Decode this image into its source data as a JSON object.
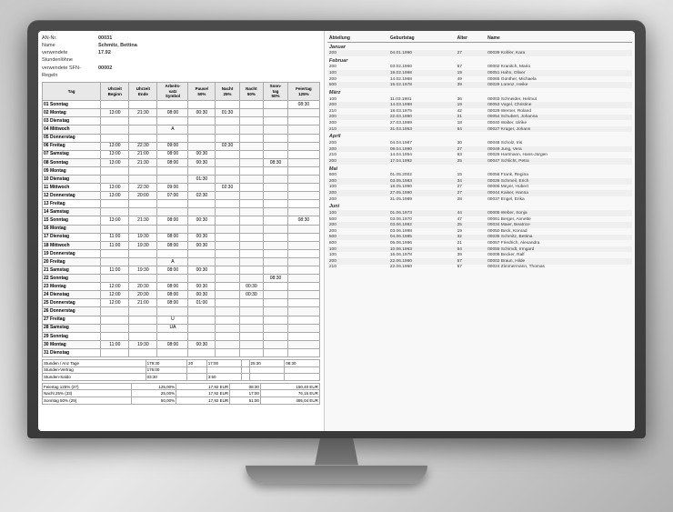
{
  "monitor": {
    "title": "Monitor Display"
  },
  "left": {
    "header": [
      {
        "label": "AN-Nr.",
        "value": "00031"
      },
      {
        "label": "Name",
        "value": "Schmitz, Bettina"
      },
      {
        "label": "verwendete Stundenlöhne",
        "value": "17.92"
      },
      {
        "label": "verwendete SFN-Regeln",
        "value": "00002"
      }
    ],
    "table_headers": [
      "Tag",
      "Uhrzeit Beginn",
      "Uhrzeit Ende",
      "Arbeitssatz Symbol",
      "Pause/ 50%",
      "Nacht 25%",
      "Nacht 50%",
      "Sonntag 50%",
      "Feiertag 125%"
    ],
    "rows": [
      {
        "nr": "01",
        "tag": "Sonntag",
        "begin": "",
        "end": "",
        "as": "",
        "pause": "",
        "n25": "",
        "n50": "",
        "so": "",
        "ft": "08:30"
      },
      {
        "nr": "02",
        "tag": "Montag",
        "begin": "13:00",
        "end": "21:30",
        "as": "08:00",
        "pause": "00:30",
        "n25": "01:30",
        "n50": "",
        "so": "",
        "ft": ""
      },
      {
        "nr": "03",
        "tag": "Dienstag",
        "begin": "",
        "end": "",
        "as": "",
        "pause": "",
        "n25": "",
        "n50": "",
        "so": "",
        "ft": ""
      },
      {
        "nr": "04",
        "tag": "Mittwoch",
        "begin": "",
        "end": "",
        "as": "A",
        "pause": "",
        "n25": "",
        "n50": "",
        "so": "",
        "ft": ""
      },
      {
        "nr": "05",
        "tag": "Donnerstag",
        "begin": "",
        "end": "",
        "as": "",
        "pause": "",
        "n25": "",
        "n50": "",
        "so": "",
        "ft": ""
      },
      {
        "nr": "06",
        "tag": "Freitag",
        "begin": "13:00",
        "end": "22:30",
        "as": "09:00",
        "pause": "",
        "n25": "02:30",
        "n50": "",
        "so": "",
        "ft": ""
      },
      {
        "nr": "07",
        "tag": "Samstag",
        "begin": "13:00",
        "end": "21:00",
        "as": "08:00",
        "pause": "00:30",
        "n25": "",
        "n50": "",
        "so": "",
        "ft": ""
      },
      {
        "nr": "08",
        "tag": "Sonntag",
        "begin": "13:00",
        "end": "21:30",
        "as": "08:00",
        "pause": "00:30",
        "n25": "",
        "n50": "",
        "so": "08:30",
        "ft": ""
      },
      {
        "nr": "09",
        "tag": "Montag",
        "begin": "",
        "end": "",
        "as": "",
        "pause": "",
        "n25": "",
        "n50": "",
        "so": "",
        "ft": ""
      },
      {
        "nr": "10",
        "tag": "Dienstag",
        "begin": "",
        "end": "",
        "as": "",
        "pause": "01:30",
        "n25": "",
        "n50": "",
        "so": "",
        "ft": ""
      },
      {
        "nr": "11",
        "tag": "Mittwoch",
        "begin": "13:00",
        "end": "22:30",
        "as": "09:00",
        "pause": "",
        "n25": "02:30",
        "n50": "",
        "so": "",
        "ft": ""
      },
      {
        "nr": "12",
        "tag": "Donnerstag",
        "begin": "13:00",
        "end": "20:00",
        "as": "07:00",
        "pause": "02:30",
        "n25": "",
        "n50": "",
        "so": "",
        "ft": ""
      },
      {
        "nr": "13",
        "tag": "Freitag",
        "begin": "",
        "end": "",
        "as": "",
        "pause": "",
        "n25": "",
        "n50": "",
        "so": "",
        "ft": ""
      },
      {
        "nr": "14",
        "tag": "Samstag",
        "begin": "",
        "end": "",
        "as": "",
        "pause": "",
        "n25": "",
        "n50": "",
        "so": "",
        "ft": ""
      },
      {
        "nr": "15",
        "tag": "Sonntag",
        "begin": "13:00",
        "end": "21:30",
        "as": "08:00",
        "pause": "00:30",
        "n25": "",
        "n50": "",
        "so": "",
        "ft": "08:30"
      },
      {
        "nr": "16",
        "tag": "Montag",
        "begin": "",
        "end": "",
        "as": "",
        "pause": "",
        "n25": "",
        "n50": "",
        "so": "",
        "ft": ""
      },
      {
        "nr": "17",
        "tag": "Dienstag",
        "begin": "11:00",
        "end": "19:30",
        "as": "08:00",
        "pause": "00:30",
        "n25": "",
        "n50": "",
        "so": "",
        "ft": ""
      },
      {
        "nr": "18",
        "tag": "Mittwoch",
        "begin": "11:00",
        "end": "19:30",
        "as": "08:00",
        "pause": "00:30",
        "n25": "",
        "n50": "",
        "so": "",
        "ft": ""
      },
      {
        "nr": "19",
        "tag": "Donnerstag",
        "begin": "",
        "end": "",
        "as": "",
        "pause": "",
        "n25": "",
        "n50": "",
        "so": "",
        "ft": ""
      },
      {
        "nr": "20",
        "tag": "Freitag",
        "begin": "",
        "end": "",
        "as": "A",
        "pause": "",
        "n25": "",
        "n50": "",
        "so": "",
        "ft": ""
      },
      {
        "nr": "21",
        "tag": "Samstag",
        "begin": "11:00",
        "end": "19:30",
        "as": "08:00",
        "pause": "00:30",
        "n25": "",
        "n50": "",
        "so": "",
        "ft": ""
      },
      {
        "nr": "22",
        "tag": "Sonntag",
        "begin": "",
        "end": "",
        "as": "",
        "pause": "",
        "n25": "",
        "n50": "",
        "so": "08:30",
        "ft": ""
      },
      {
        "nr": "23",
        "tag": "Montag",
        "begin": "12:00",
        "end": "20:30",
        "as": "08:00",
        "pause": "00:30",
        "n25": "",
        "n50": "00:30",
        "so": "",
        "ft": ""
      },
      {
        "nr": "24",
        "tag": "Dienstag",
        "begin": "12:00",
        "end": "20:30",
        "as": "08:00",
        "pause": "00:30",
        "n25": "",
        "n50": "00:30",
        "so": "",
        "ft": ""
      },
      {
        "nr": "25",
        "tag": "Donnerstag",
        "begin": "12:00",
        "end": "21:00",
        "as": "08:00",
        "pause": "01:00",
        "n25": "",
        "n50": "",
        "so": "",
        "ft": ""
      },
      {
        "nr": "26",
        "tag": "Donnerstag",
        "begin": "",
        "end": "",
        "as": "",
        "pause": "",
        "n25": "",
        "n50": "",
        "so": "",
        "ft": ""
      },
      {
        "nr": "27",
        "tag": "Freitag",
        "begin": "",
        "end": "",
        "as": "U",
        "pause": "",
        "n25": "",
        "n50": "",
        "so": "",
        "ft": ""
      },
      {
        "nr": "28",
        "tag": "Samstag",
        "begin": "",
        "end": "",
        "as": "UA",
        "pause": "",
        "n25": "",
        "n50": "",
        "so": "",
        "ft": ""
      },
      {
        "nr": "29",
        "tag": "Sonntag",
        "begin": "",
        "end": "",
        "as": "",
        "pause": "",
        "n25": "",
        "n50": "",
        "so": "",
        "ft": ""
      },
      {
        "nr": "30",
        "tag": "Montag",
        "begin": "11:00",
        "end": "19:30",
        "as": "08:00",
        "pause": "00:30",
        "n25": "",
        "n50": "",
        "so": "",
        "ft": ""
      },
      {
        "nr": "31",
        "tag": "Dienstag",
        "begin": "",
        "end": "",
        "as": "",
        "pause": "",
        "n25": "",
        "n50": "",
        "so": "",
        "ft": ""
      }
    ],
    "summary": [
      {
        "label": "Stunden / Anz Tage",
        "v1": "179:30",
        "v2": "20",
        "v3": "17:00",
        "v4": "",
        "v5": "25:30",
        "v6": "08:30"
      },
      {
        "label": "Stunden-Vertrag",
        "v1": "176:00",
        "v2": "",
        "v3": "",
        "v4": "",
        "v5": "",
        "v6": ""
      },
      {
        "label": "Stunden-Saldo",
        "v1": "03:30",
        "v2": "",
        "v3": "3:50",
        "v4": "",
        "v5": "",
        "v6": ""
      }
    ],
    "fees": [
      {
        "label": "Feiertag 125% (27)",
        "pct": "125,00%",
        "rate": "17,92 EUR",
        "hrs": "08:30",
        "total": "150,40 EUR"
      },
      {
        "label": "Nacht 25% (33)",
        "pct": "25,00%",
        "rate": "17,92 EUR",
        "hrs": "17:00",
        "total": "76,16 EUR"
      },
      {
        "label": "Sonntag 50% (29)",
        "pct": "50,00%",
        "rate": "17,92 EUR",
        "hrs": "51:00",
        "total": "495,04 EUR"
      }
    ]
  },
  "right": {
    "col_headers": [
      "Abteilung",
      "Geburtstag",
      "Alter",
      "Name"
    ],
    "months": [
      {
        "name": "Januar",
        "rows": [
          {
            "abt": "200",
            "geb": "04.01.1990",
            "alt": "27",
            "name": "00039 Kohler, Kara"
          }
        ]
      },
      {
        "name": "Februar",
        "rows": [
          {
            "abt": "200",
            "geb": "03.02.1960",
            "alt": "57",
            "name": "00002 Kranitch, Mario"
          },
          {
            "abt": "100",
            "geb": "19.02.1998",
            "alt": "19",
            "name": "00051 Hahn, Oliver"
          },
          {
            "abt": "200",
            "geb": "14.02.1968",
            "alt": "49",
            "name": "00065 Günther, Michaela"
          },
          {
            "abt": "500",
            "geb": "15.02.1978",
            "alt": "39",
            "name": "00029 Lorenz, Heike"
          }
        ]
      },
      {
        "name": "März",
        "rows": [
          {
            "abt": "100",
            "geb": "11.03.1981",
            "alt": "36",
            "name": "00003 Schneider, Helmut"
          },
          {
            "abt": "200",
            "geb": "14.03.1998",
            "alt": "19",
            "name": "00053 Vogel, Christine"
          },
          {
            "abt": "210",
            "geb": "18.03.1975",
            "alt": "42",
            "name": "00029 Werner, Roland"
          },
          {
            "abt": "200",
            "geb": "22.03.1990",
            "alt": "21",
            "name": "00054 Schubert, Johanna"
          },
          {
            "abt": "200",
            "geb": "27.03.1999",
            "alt": "18",
            "name": "00040 Walter, Ulrike"
          },
          {
            "abt": "210",
            "geb": "31.03.1953",
            "alt": "64",
            "name": "00027 Krüger, Johann"
          }
        ]
      },
      {
        "name": "April",
        "rows": [
          {
            "abt": "200",
            "geb": "04.04.1987",
            "alt": "30",
            "name": "00048 Scholz, Iris"
          },
          {
            "abt": "200",
            "geb": "08.04.1990",
            "alt": "27",
            "name": "00049 Jung, Vera"
          },
          {
            "abt": "210",
            "geb": "14.04.1954",
            "alt": "63",
            "name": "00026 Hartmann, Hans-Jürgen"
          },
          {
            "abt": "200",
            "geb": "17.04.1992",
            "alt": "25",
            "name": "00047 Schlicht, Petra"
          }
        ]
      },
      {
        "name": "Mai",
        "rows": [
          {
            "abt": "600",
            "geb": "01.05.2002",
            "alt": "15",
            "name": "00056 Frank, Regina"
          },
          {
            "abt": "200",
            "geb": "03.05.1983",
            "alt": "34",
            "name": "00028 Schmeil, Erich"
          },
          {
            "abt": "100",
            "geb": "18.05.1990",
            "alt": "27",
            "name": "00006 Meyer, Hubert"
          },
          {
            "abt": "200",
            "geb": "27.05.1990",
            "alt": "27",
            "name": "00044 Kaiser, Hanna"
          },
          {
            "abt": "200",
            "geb": "31.05.1989",
            "alt": "28",
            "name": "00037 Engel, Erika"
          }
        ]
      },
      {
        "name": "Juni",
        "rows": [
          {
            "abt": "100",
            "geb": "01.06.1973",
            "alt": "44",
            "name": "00005 Weber, Sonja"
          },
          {
            "abt": "500",
            "geb": "03.06.1970",
            "alt": "47",
            "name": "00061 Berger, Annette"
          },
          {
            "abt": "200",
            "geb": "03.06.1992",
            "alt": "25",
            "name": "00034 Maier, Beatrice"
          },
          {
            "abt": "200",
            "geb": "03.06.1998",
            "alt": "19",
            "name": "00050 Beck, Konrad"
          },
          {
            "abt": "500",
            "geb": "04.06.1985",
            "alt": "32",
            "name": "00035 Schmitz, Bettina"
          },
          {
            "abt": "600",
            "geb": "06.06.1996",
            "alt": "21",
            "name": "00057 Friedrich, Alexandra"
          },
          {
            "abt": "100",
            "geb": "10.06.1963",
            "alt": "54",
            "name": "00055 Schimdt, Irmgard"
          },
          {
            "abt": "100",
            "geb": "16.06.1978",
            "alt": "39",
            "name": "00008 Becker, Ralf"
          },
          {
            "abt": "200",
            "geb": "22.06.1960",
            "alt": "57",
            "name": "00002 Braun, Hilde"
          },
          {
            "abt": "210",
            "geb": "22.06.1960",
            "alt": "57",
            "name": "00024 Zimmermann, Thomas"
          }
        ]
      }
    ]
  }
}
